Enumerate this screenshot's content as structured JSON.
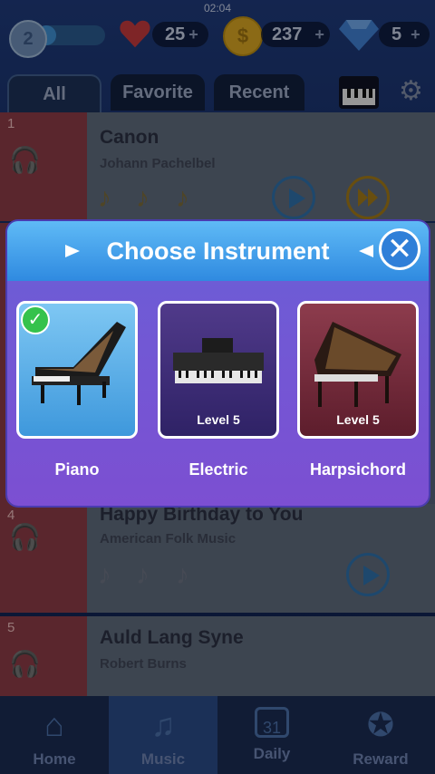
{
  "status": {
    "time": "02:04"
  },
  "stats": {
    "level": "2",
    "lives": "25",
    "coins": "237",
    "gems": "5",
    "plus": "+"
  },
  "tabs": [
    "All",
    "Favorite",
    "Recent"
  ],
  "songs": [
    {
      "num": "1",
      "title": "Canon",
      "artist": "Johann Pachelbel"
    },
    {
      "num": "4",
      "title": "Happy Birthday to You",
      "artist": "American Folk Music"
    },
    {
      "num": "5",
      "title": "Auld Lang Syne",
      "artist": "Robert Burns"
    }
  ],
  "nav": [
    "Home",
    "Music",
    "Daily",
    "Reward"
  ],
  "daily_badge": "31",
  "modal": {
    "title": "Choose Instrument",
    "instruments": [
      {
        "name": "Piano",
        "level": ""
      },
      {
        "name": "Electric",
        "level": "Level 5"
      },
      {
        "name": "Harpsichord",
        "level": "Level 5"
      }
    ]
  },
  "icons": {
    "headphones": "headphones-icon",
    "play": "play-icon",
    "fastforward": "fast-forward-icon",
    "close": "close-icon",
    "check": "check-icon",
    "settings": "gear-icon"
  },
  "colors": {
    "accent": "#2f8ae0",
    "modal": "#7c4fd2"
  }
}
